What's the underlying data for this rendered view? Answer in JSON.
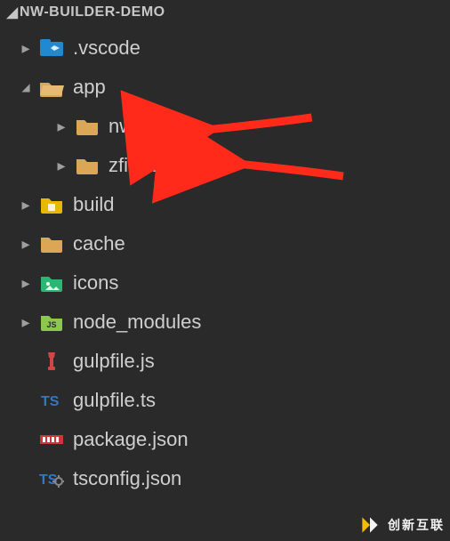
{
  "header": {
    "title": "NW-BUILDER-DEMO"
  },
  "tree": [
    {
      "id": "vscode",
      "indent": 0,
      "expandable": true,
      "expanded": false,
      "icon": "folder-vscode",
      "label": ".vscode",
      "arrow": false
    },
    {
      "id": "app",
      "indent": 0,
      "expandable": true,
      "expanded": true,
      "icon": "folder-open",
      "label": "app",
      "arrow": false
    },
    {
      "id": "nw-demo",
      "indent": 1,
      "expandable": true,
      "expanded": false,
      "icon": "folder",
      "label": "nw-demo",
      "arrow": true
    },
    {
      "id": "zfile",
      "indent": 1,
      "expandable": true,
      "expanded": false,
      "icon": "folder",
      "label": "zfile-explorer",
      "arrow": true
    },
    {
      "id": "build",
      "indent": 0,
      "expandable": true,
      "expanded": false,
      "icon": "folder-build",
      "label": "build",
      "arrow": false
    },
    {
      "id": "cache",
      "indent": 0,
      "expandable": true,
      "expanded": false,
      "icon": "folder",
      "label": "cache",
      "arrow": false
    },
    {
      "id": "icons",
      "indent": 0,
      "expandable": true,
      "expanded": false,
      "icon": "folder-images",
      "label": "icons",
      "arrow": false
    },
    {
      "id": "node_modules",
      "indent": 0,
      "expandable": true,
      "expanded": false,
      "icon": "folder-node",
      "label": "node_modules",
      "arrow": false
    },
    {
      "id": "gulpfilejs",
      "indent": 0,
      "expandable": false,
      "expanded": false,
      "icon": "file-gulp",
      "label": "gulpfile.js",
      "arrow": false
    },
    {
      "id": "gulpfilets",
      "indent": 0,
      "expandable": false,
      "expanded": false,
      "icon": "file-ts",
      "label": "gulpfile.ts",
      "arrow": false
    },
    {
      "id": "packagejson",
      "indent": 0,
      "expandable": false,
      "expanded": false,
      "icon": "file-npm",
      "label": "package.json",
      "arrow": false
    },
    {
      "id": "tsconfig",
      "indent": 0,
      "expandable": false,
      "expanded": false,
      "icon": "file-tsconfig",
      "label": "tsconfig.json",
      "arrow": false
    }
  ],
  "watermark": {
    "text": "创新互联"
  },
  "colors": {
    "arrow": "#ff2a1a",
    "folder": "#dca657",
    "folderOpen": "#dca657",
    "vscode": "#1f8ad2",
    "build": "#e6b800",
    "images": "#2bb673",
    "node": "#8cc84b",
    "gulp": "#cf4647",
    "ts": "#3178c6",
    "npm": "#cb3837",
    "logo": "#ffc400"
  }
}
